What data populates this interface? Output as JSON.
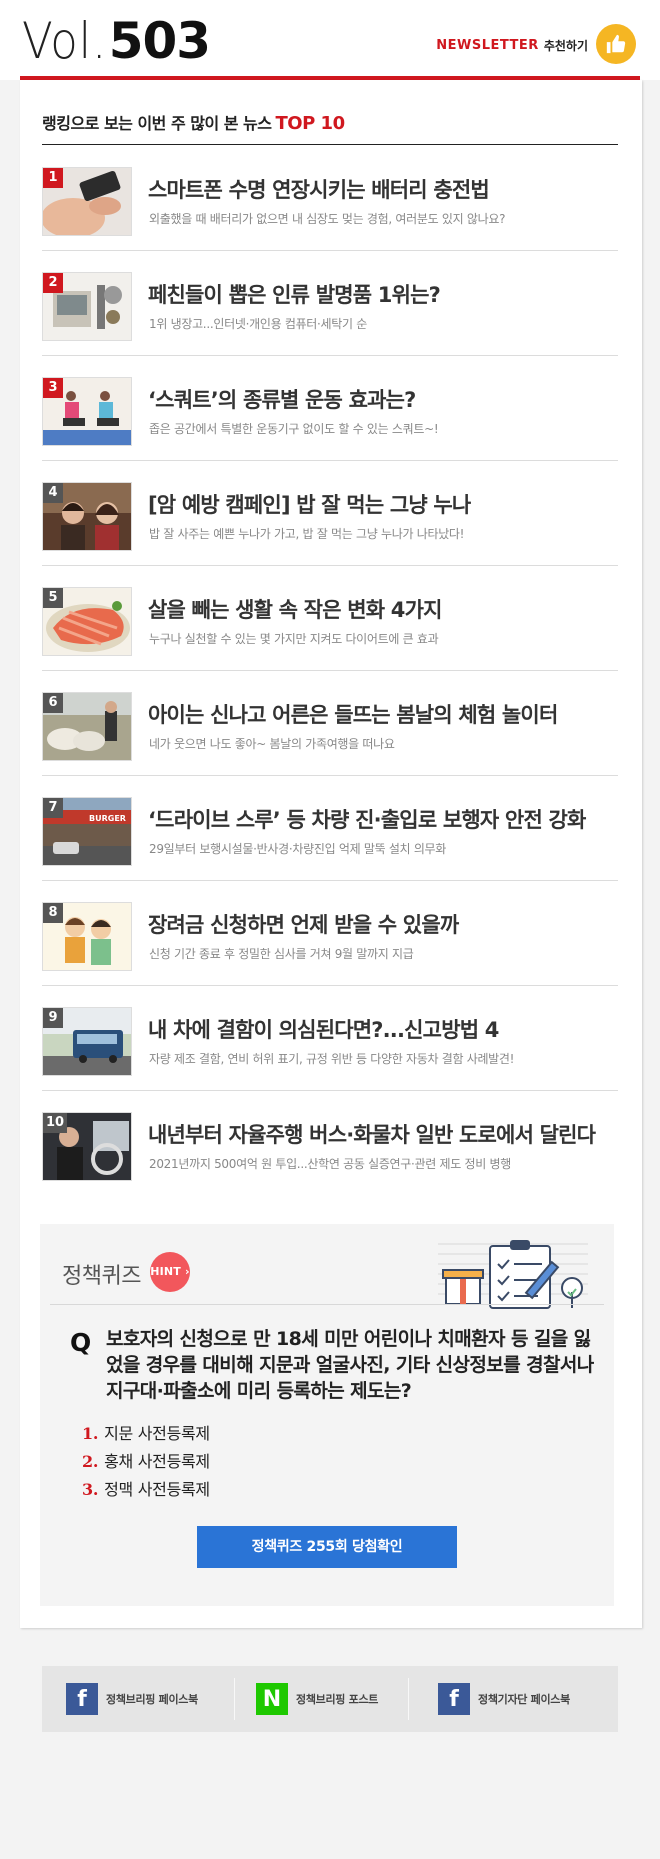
{
  "header": {
    "vol_label": "Vol.",
    "vol_number": "503",
    "newsletter_brand": "NEWSLETTER",
    "recommend_label": "추천하기",
    "accent_color": "#d0181f",
    "thumb_icon": "thumbs-up-icon"
  },
  "ranking": {
    "title": "랭킹으로 보는 이번 주 많이 본 뉴스",
    "title_highlight": "TOP 10",
    "items": [
      {
        "rank": "1",
        "title": "스마트폰 수명 연장시키는 배터리 충전법",
        "subtitle": "외출했을 때 배터리가 없으면 내 심장도 멎는 경험, 여러분도 있지 않나요?"
      },
      {
        "rank": "2",
        "title": "페친들이 뽑은 인류 발명품 1위는?",
        "subtitle": "1위 냉장고...인터넷·개인용 컴퓨터·세탁기 순"
      },
      {
        "rank": "3",
        "title": "‘스쿼트’의 종류별 운동 효과는?",
        "subtitle": "좁은 공간에서 특별한 운동기구 없이도 할 수 있는 스쿼트~!"
      },
      {
        "rank": "4",
        "title": "[암 예방 캠페인] 밥 잘 먹는 그냥 누나",
        "subtitle": "밥 잘 사주는 예쁜 누나가 가고, 밥 잘 먹는 그냥 누나가 나타났다!"
      },
      {
        "rank": "5",
        "title": "살을 빼는 생활 속 작은 변화 4가지",
        "subtitle": "누구나 실천할 수 있는 몇 가지만 지켜도 다이어트에 큰 효과"
      },
      {
        "rank": "6",
        "title": "아이는 신나고 어른은 들뜨는 봄날의 체험 놀이터",
        "subtitle": "네가 웃으면 나도 좋아~ 봄날의 가족여행을 떠나요"
      },
      {
        "rank": "7",
        "title": "‘드라이브 스루’ 등 차량 진·출입로 보행자 안전 강화",
        "subtitle": "29일부터 보행시설물·반사경·차량진입 억제 말뚝 설치 의무화"
      },
      {
        "rank": "8",
        "title": "장려금 신청하면 언제 받을 수 있을까",
        "subtitle": "신청 기간 종료 후 정밀한 심사를 거쳐 9월 말까지 지급"
      },
      {
        "rank": "9",
        "title": "내 차에 결함이 의심된다면?...신고방법 4",
        "subtitle": "자량 제조 결함, 연비 허위 표기, 규정 위반 등 다양한 자동차 결함 사례발견!"
      },
      {
        "rank": "10",
        "title": "내년부터 자율주행 버스·화물차 일반 도로에서 달린다",
        "subtitle": "2021년까지 500여억 원 투입...산학연 공동 실증연구·관련 제도 정비 병행"
      }
    ]
  },
  "quiz": {
    "title": "정책퀴즈",
    "hint_label": "HINT",
    "q_mark": "Q",
    "question": "보호자의 신청으로 만 18세 미만 어린이나 치매환자 등 길을 잃었을 경우를 대비해 지문과 얼굴사진, 기타 신상정보를 경찰서나 지구대·파출소에 미리 등록하는 제도는?",
    "options": [
      {
        "num": "1.",
        "text": "지문 사전등록제"
      },
      {
        "num": "2.",
        "text": "홍채 사전등록제"
      },
      {
        "num": "3.",
        "text": "정맥 사전등록제"
      }
    ],
    "button_label": "정책퀴즈 255회 당첨확인"
  },
  "footer": {
    "links": [
      {
        "icon": "facebook-icon",
        "glyph": "f",
        "label": "정책브리핑 페이스북",
        "color": "#3b5998"
      },
      {
        "icon": "naver-n-icon",
        "glyph": "N",
        "label": "정책브리핑 포스트",
        "color": "#1ec800"
      },
      {
        "icon": "facebook-icon",
        "glyph": "f",
        "label": "정책기자단 페이스북",
        "color": "#3b5998"
      }
    ]
  }
}
